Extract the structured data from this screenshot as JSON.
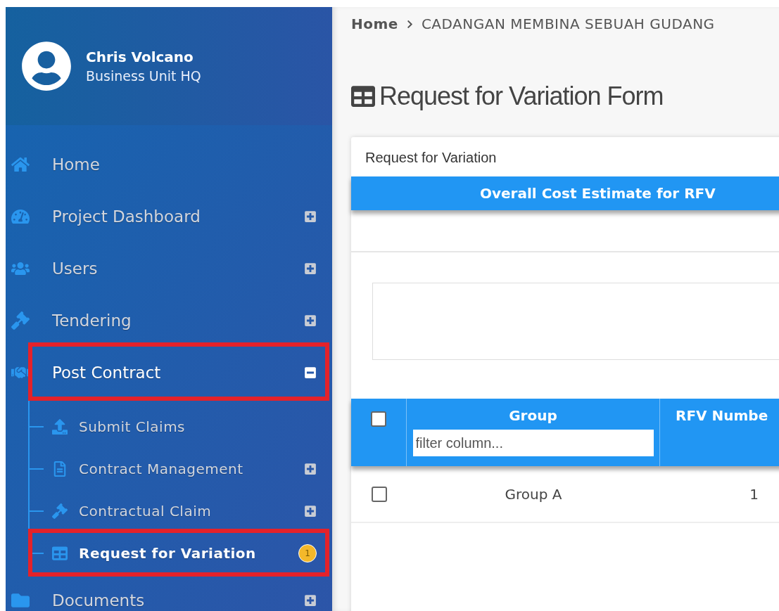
{
  "user": {
    "name": "Chris Volcano",
    "unit": "Business Unit HQ"
  },
  "nav": [
    {
      "label": "Home",
      "kind": "link",
      "selected": false,
      "highlighted": false
    },
    {
      "label": "Project Dashboard",
      "kind": "group",
      "expanded": false,
      "selected": false,
      "highlighted": false
    },
    {
      "label": "Users",
      "kind": "group",
      "expanded": false,
      "selected": false,
      "highlighted": false
    },
    {
      "label": "Tendering",
      "kind": "group",
      "expanded": false,
      "selected": false,
      "highlighted": false
    },
    {
      "label": "Post Contract",
      "kind": "group",
      "expanded": true,
      "selected": false,
      "highlighted": true,
      "children": [
        {
          "label": "Submit Claims",
          "kind": "link",
          "selected": false,
          "highlighted": false
        },
        {
          "label": "Contract Management",
          "kind": "group",
          "expanded": false,
          "selected": false,
          "highlighted": false
        },
        {
          "label": "Contractual Claim",
          "kind": "group",
          "expanded": false,
          "selected": false,
          "highlighted": false
        },
        {
          "label": "Request for Variation",
          "kind": "link",
          "selected": true,
          "highlighted": true,
          "badge": "1"
        }
      ]
    },
    {
      "label": "Documents",
      "kind": "group",
      "expanded": false,
      "selected": false,
      "highlighted": false
    }
  ],
  "breadcrumb": [
    "Home",
    "CADANGAN MEMBINA SEBUAH GUDANG"
  ],
  "page_title": "Request for Variation Form",
  "card": {
    "title": "Request for Variation",
    "section": "Overall Cost Estimate for RFV",
    "table": {
      "select_all": {
        "checked": false
      },
      "columns": [
        {
          "label": "Group",
          "filter_placeholder": "filter column..."
        },
        {
          "label": "RFV Numbe"
        }
      ],
      "rows": [
        {
          "checked": false,
          "cells": [
            "Group A",
            "1"
          ]
        }
      ]
    }
  }
}
